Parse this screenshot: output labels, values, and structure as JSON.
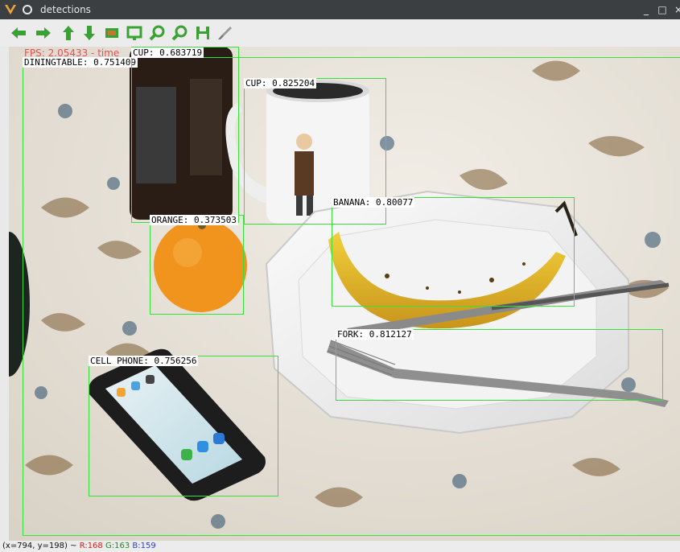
{
  "window": {
    "title": "detections"
  },
  "toolbar": {
    "buttons": [
      {
        "name": "pan-left-icon"
      },
      {
        "name": "pan-right-icon"
      },
      {
        "name": "pan-up-icon"
      },
      {
        "name": "pan-down-icon"
      },
      {
        "name": "zoom-fit-icon"
      },
      {
        "name": "zoom-window-icon"
      },
      {
        "name": "zoom-in-icon"
      },
      {
        "name": "zoom-out-icon"
      },
      {
        "name": "save-icon"
      },
      {
        "name": "properties-icon"
      }
    ]
  },
  "overlay": {
    "fps_text": "FPS: 2.05433 - time"
  },
  "detections": [
    {
      "label": "DININGTABLE: 0.751409"
    },
    {
      "label": "CUP: 0.683719"
    },
    {
      "label": "CUP: 0.825204"
    },
    {
      "label": "BANANA: 0.80077"
    },
    {
      "label": "ORANGE: 0.373503"
    },
    {
      "label": "FORK: 0.812127"
    },
    {
      "label": "CELL PHONE: 0.756256"
    }
  ],
  "status": {
    "coords": "(x=794, y=198) ~",
    "r": "R:168",
    "g": "G:163",
    "b": "B:159"
  },
  "colors": {
    "box": "#36e23a",
    "titlebar": "#3c3f41"
  }
}
